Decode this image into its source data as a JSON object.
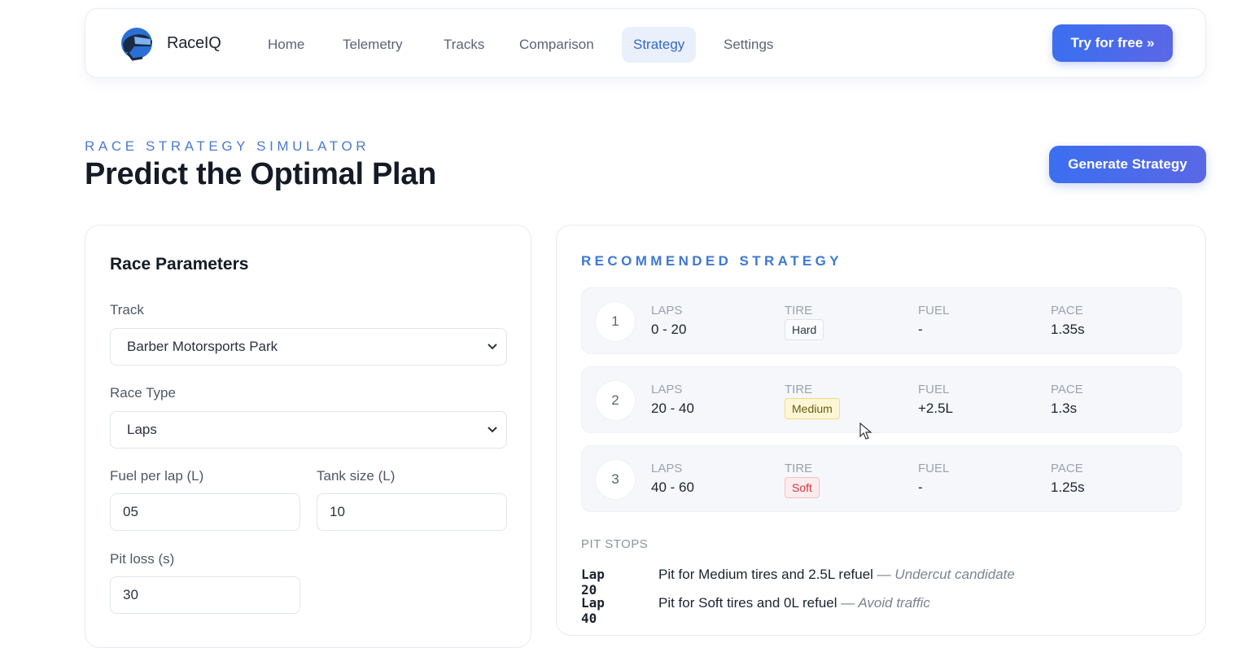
{
  "nav": {
    "brand": "RaceIQ",
    "items": [
      {
        "label": "Home"
      },
      {
        "label": "Telemetry"
      },
      {
        "label": "Tracks"
      },
      {
        "label": "Comparison"
      },
      {
        "label": "Strategy",
        "active": true
      },
      {
        "label": "Settings"
      }
    ],
    "cta": "Try for free  »",
    "logo_icon": "helmet-icon"
  },
  "header": {
    "eyebrow": "RACE STRATEGY SIMULATOR",
    "title": "Predict the Optimal Plan",
    "generate": "Generate Strategy"
  },
  "params": {
    "title": "Race Parameters",
    "track_label": "Track",
    "track_value": "Barber Motorsports Park",
    "race_type_label": "Race Type",
    "race_type_value": "Laps",
    "fuel_label": "Fuel per lap (L)",
    "fuel_value": "05",
    "tank_label": "Tank size (L)",
    "tank_value": "10",
    "pit_label": "Pit loss (s)",
    "pit_value": "30"
  },
  "strategy": {
    "title": "RECOMMENDED STRATEGY",
    "col_laps": "LAPS",
    "col_tire": "TIRE",
    "col_fuel": "FUEL",
    "col_pace": "PACE",
    "stints": [
      {
        "num": "1",
        "laps": "0 - 20",
        "tire": "Hard",
        "fuel": "-",
        "pace": "1.35s"
      },
      {
        "num": "2",
        "laps": "20 - 40",
        "tire": "Medium",
        "fuel": "+2.5L",
        "pace": "1.3s"
      },
      {
        "num": "3",
        "laps": "40 - 60",
        "tire": "Soft",
        "fuel": "-",
        "pace": "1.25s"
      }
    ],
    "pit_title": "PIT STOPS",
    "pits": [
      {
        "lap": "Lap 20",
        "text": "Pit for Medium tires and 2.5L refuel",
        "note": "— Undercut candidate"
      },
      {
        "lap": "Lap 40",
        "text": "Pit for Soft tires and 0L refuel",
        "note": "— Avoid traffic"
      }
    ]
  },
  "colors": {
    "accent": "#3b6ff0",
    "medium_tire": "#fdf6d5",
    "soft_tire": "#d0323f"
  }
}
